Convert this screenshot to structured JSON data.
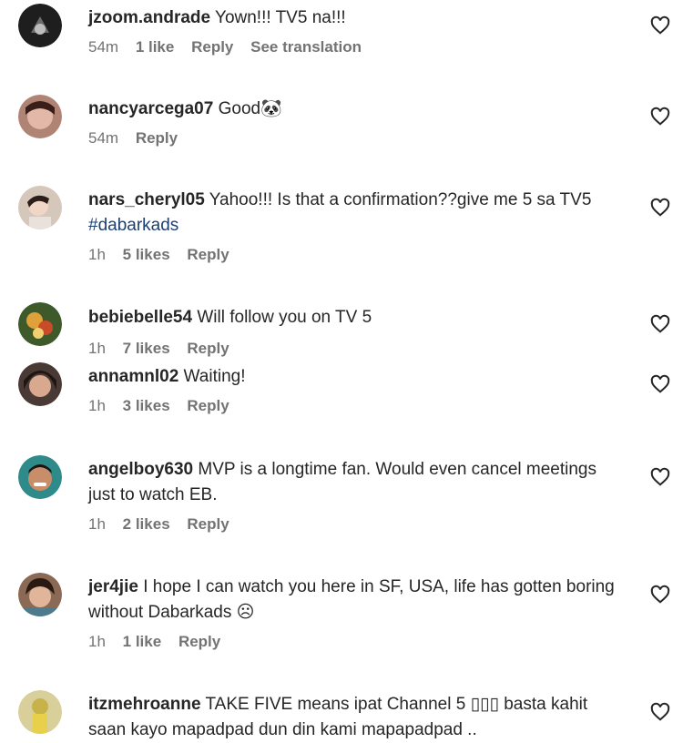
{
  "comments": [
    {
      "username": "jzoom.andrade",
      "text": "Yown!!! TV5 na!!!",
      "hashtag": "",
      "time": "54m",
      "likes": "1 like",
      "reply": "Reply",
      "translate": "See translation",
      "avatar_color": "#1e1e1e"
    },
    {
      "username": "nancyarcega07",
      "text": "Good",
      "hashtag": "",
      "emoji": "🐼",
      "time": "54m",
      "likes": "",
      "reply": "Reply",
      "avatar_color": "#8e5a4e"
    },
    {
      "username": "nars_cheryl05",
      "text": "Yahoo!!! Is that a confirmation??give me 5 sa TV5",
      "hashtag": "#dabarkads",
      "time": "1h",
      "likes": "5 likes",
      "reply": "Reply",
      "avatar_color": "#c9b6a8"
    },
    {
      "username": "bebiebelle54",
      "text": "Will follow you on TV 5",
      "hashtag": "",
      "time": "1h",
      "likes": "7 likes",
      "reply": "Reply",
      "avatar_color": "#3e5a2a"
    },
    {
      "username": "annamnl02",
      "text": "Waiting!",
      "hashtag": "",
      "time": "1h",
      "likes": "3 likes",
      "reply": "Reply",
      "avatar_color": "#4a3a36"
    },
    {
      "username": "angelboy630",
      "text": "MVP is a longtime fan. Would even cancel meetings just to watch EB.",
      "hashtag": "",
      "time": "1h",
      "likes": "2 likes",
      "reply": "Reply",
      "avatar_color": "#2f8a8a"
    },
    {
      "username": "jer4jie",
      "text": "I hope I can watch you here in SF, USA, life has gotten boring without Dabarkads ☹",
      "hashtag": "",
      "time": "1h",
      "likes": "1 like",
      "reply": "Reply",
      "avatar_color": "#7a5b48"
    },
    {
      "username": "itzmehroanne",
      "text": "TAKE FIVE means ipat Channel 5 ▯▯▯ basta kahit saan kayo mapadpad dun din kami mapapadpad ..",
      "hashtag": "",
      "time": "",
      "likes": "",
      "reply": "",
      "avatar_color": "#c8b34a"
    }
  ],
  "icons": {
    "like": "heart-outline-icon"
  }
}
